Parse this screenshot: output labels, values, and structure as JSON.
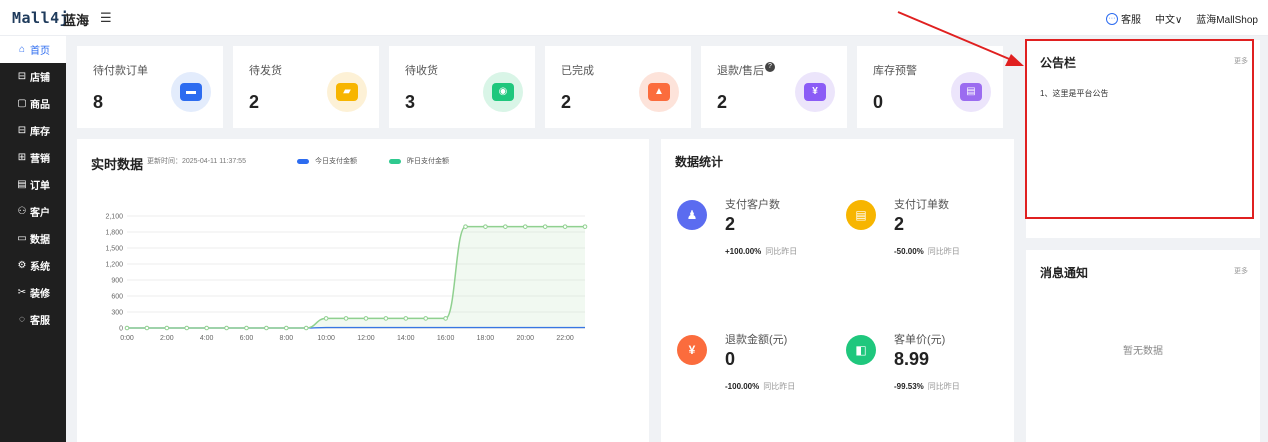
{
  "header": {
    "logo": "Mall4j",
    "shop_name": "蓝海",
    "fold_icon": "menu-fold-icon",
    "customer_service": "客服",
    "language": "中文∨",
    "user": "蓝海MallShop"
  },
  "sidebar": {
    "items": [
      {
        "label": "首页",
        "icon": "home-icon",
        "glyph": "⌂"
      },
      {
        "label": "店铺",
        "icon": "shop-icon",
        "glyph": "⊟"
      },
      {
        "label": "商品",
        "icon": "goods-icon",
        "glyph": "▢"
      },
      {
        "label": "库存",
        "icon": "stock-icon",
        "glyph": "⊟"
      },
      {
        "label": "营销",
        "icon": "gift-icon",
        "glyph": "⊞"
      },
      {
        "label": "订单",
        "icon": "order-icon",
        "glyph": "▤"
      },
      {
        "label": "客户",
        "icon": "customer-icon",
        "glyph": "⚇"
      },
      {
        "label": "数据",
        "icon": "data-icon",
        "glyph": "▭"
      },
      {
        "label": "系统",
        "icon": "system-icon",
        "glyph": "⚙"
      },
      {
        "label": "装修",
        "icon": "decorate-icon",
        "glyph": "✂"
      },
      {
        "label": "客服",
        "icon": "service-icon",
        "glyph": "◌"
      }
    ]
  },
  "stats": [
    {
      "label": "待付款订单",
      "value": "8",
      "icon": "wallet-icon",
      "bg": "#e3ecfc",
      "fg": "#2d6cf0",
      "glyph": "▬"
    },
    {
      "label": "待发货",
      "value": "2",
      "icon": "truck-icon",
      "bg": "#fdf1d6",
      "fg": "#f7b500",
      "glyph": "▰"
    },
    {
      "label": "待收货",
      "value": "3",
      "icon": "headset-icon",
      "bg": "#d9f5e7",
      "fg": "#1fc77d",
      "glyph": "◉"
    },
    {
      "label": "已完成",
      "value": "2",
      "icon": "bag-icon",
      "bg": "#fde3da",
      "fg": "#fb6c3d",
      "glyph": "▲"
    },
    {
      "label": "退款/售后",
      "value": "2",
      "icon": "moneybag-icon",
      "bg": "#ece5fb",
      "fg": "#8b5cf6",
      "glyph": "¥"
    },
    {
      "label": "库存预警",
      "value": "0",
      "icon": "box-icon",
      "bg": "#ece5fb",
      "fg": "#9b6cf0",
      "glyph": "▤"
    }
  ],
  "realtime": {
    "title": "实时数据",
    "updated": "更新时间：2025-04-11  11:37:55",
    "legend_today": "今日支付金额",
    "legend_yesterday": "昨日支付金额"
  },
  "chart_data": {
    "type": "line",
    "x": [
      "0:00",
      "1:00",
      "2:00",
      "3:00",
      "4:00",
      "5:00",
      "6:00",
      "7:00",
      "8:00",
      "9:00",
      "10:00",
      "11:00",
      "12:00",
      "13:00",
      "14:00",
      "15:00",
      "16:00",
      "17:00",
      "18:00",
      "19:00",
      "20:00",
      "21:00",
      "22:00",
      "23:00"
    ],
    "x_tick_labels": [
      "0:00",
      "2:00",
      "4:00",
      "6:00",
      "8:00",
      "10:00",
      "12:00",
      "14:00",
      "16:00",
      "18:00",
      "20:00",
      "22:00"
    ],
    "y_tick_labels": [
      "0",
      "300",
      "600",
      "900",
      "1,200",
      "1,500",
      "1,800",
      "2,100"
    ],
    "ylim": [
      0,
      2100
    ],
    "series": [
      {
        "name": "今日支付金额",
        "color": "#2d6cf0",
        "values": [
          0,
          0,
          0,
          0,
          0,
          0,
          0,
          0,
          0,
          0,
          10,
          10,
          10,
          10,
          10,
          10,
          10,
          10,
          10,
          10,
          10,
          10,
          10,
          10
        ]
      },
      {
        "name": "昨日支付金额",
        "color": "#8fd08f",
        "values": [
          0,
          0,
          0,
          0,
          0,
          0,
          0,
          0,
          0,
          0,
          180,
          180,
          180,
          180,
          180,
          180,
          180,
          1900,
          1900,
          1900,
          1900,
          1900,
          1900,
          1900
        ]
      }
    ]
  },
  "data_stats": {
    "title": "数据统计",
    "metrics": [
      {
        "label": "支付客户数",
        "value": "2",
        "change": "+100.00%",
        "compare": "同比昨日",
        "icon": "user-icon",
        "color": "#5b6cf0",
        "glyph": "♟"
      },
      {
        "label": "支付订单数",
        "value": "2",
        "change": "-50.00%",
        "compare": "同比昨日",
        "icon": "clipboard-icon",
        "color": "#f7b500",
        "glyph": "▤"
      },
      {
        "label": "退款金额(元)",
        "value": "0",
        "change": "-100.00%",
        "compare": "同比昨日",
        "icon": "refund-icon",
        "color": "#fb6c3d",
        "glyph": "¥"
      },
      {
        "label": "客单价(元)",
        "value": "8.99",
        "change": "-99.53%",
        "compare": "同比昨日",
        "icon": "shopping-bag-icon",
        "color": "#1fc77d",
        "glyph": "◧"
      }
    ]
  },
  "announcement": {
    "title": "公告栏",
    "more": "更多",
    "item": "1、这里是平台公告"
  },
  "messages": {
    "title": "消息通知",
    "more": "更多",
    "empty": "暂无数据"
  },
  "annotation_color": "#e02020"
}
